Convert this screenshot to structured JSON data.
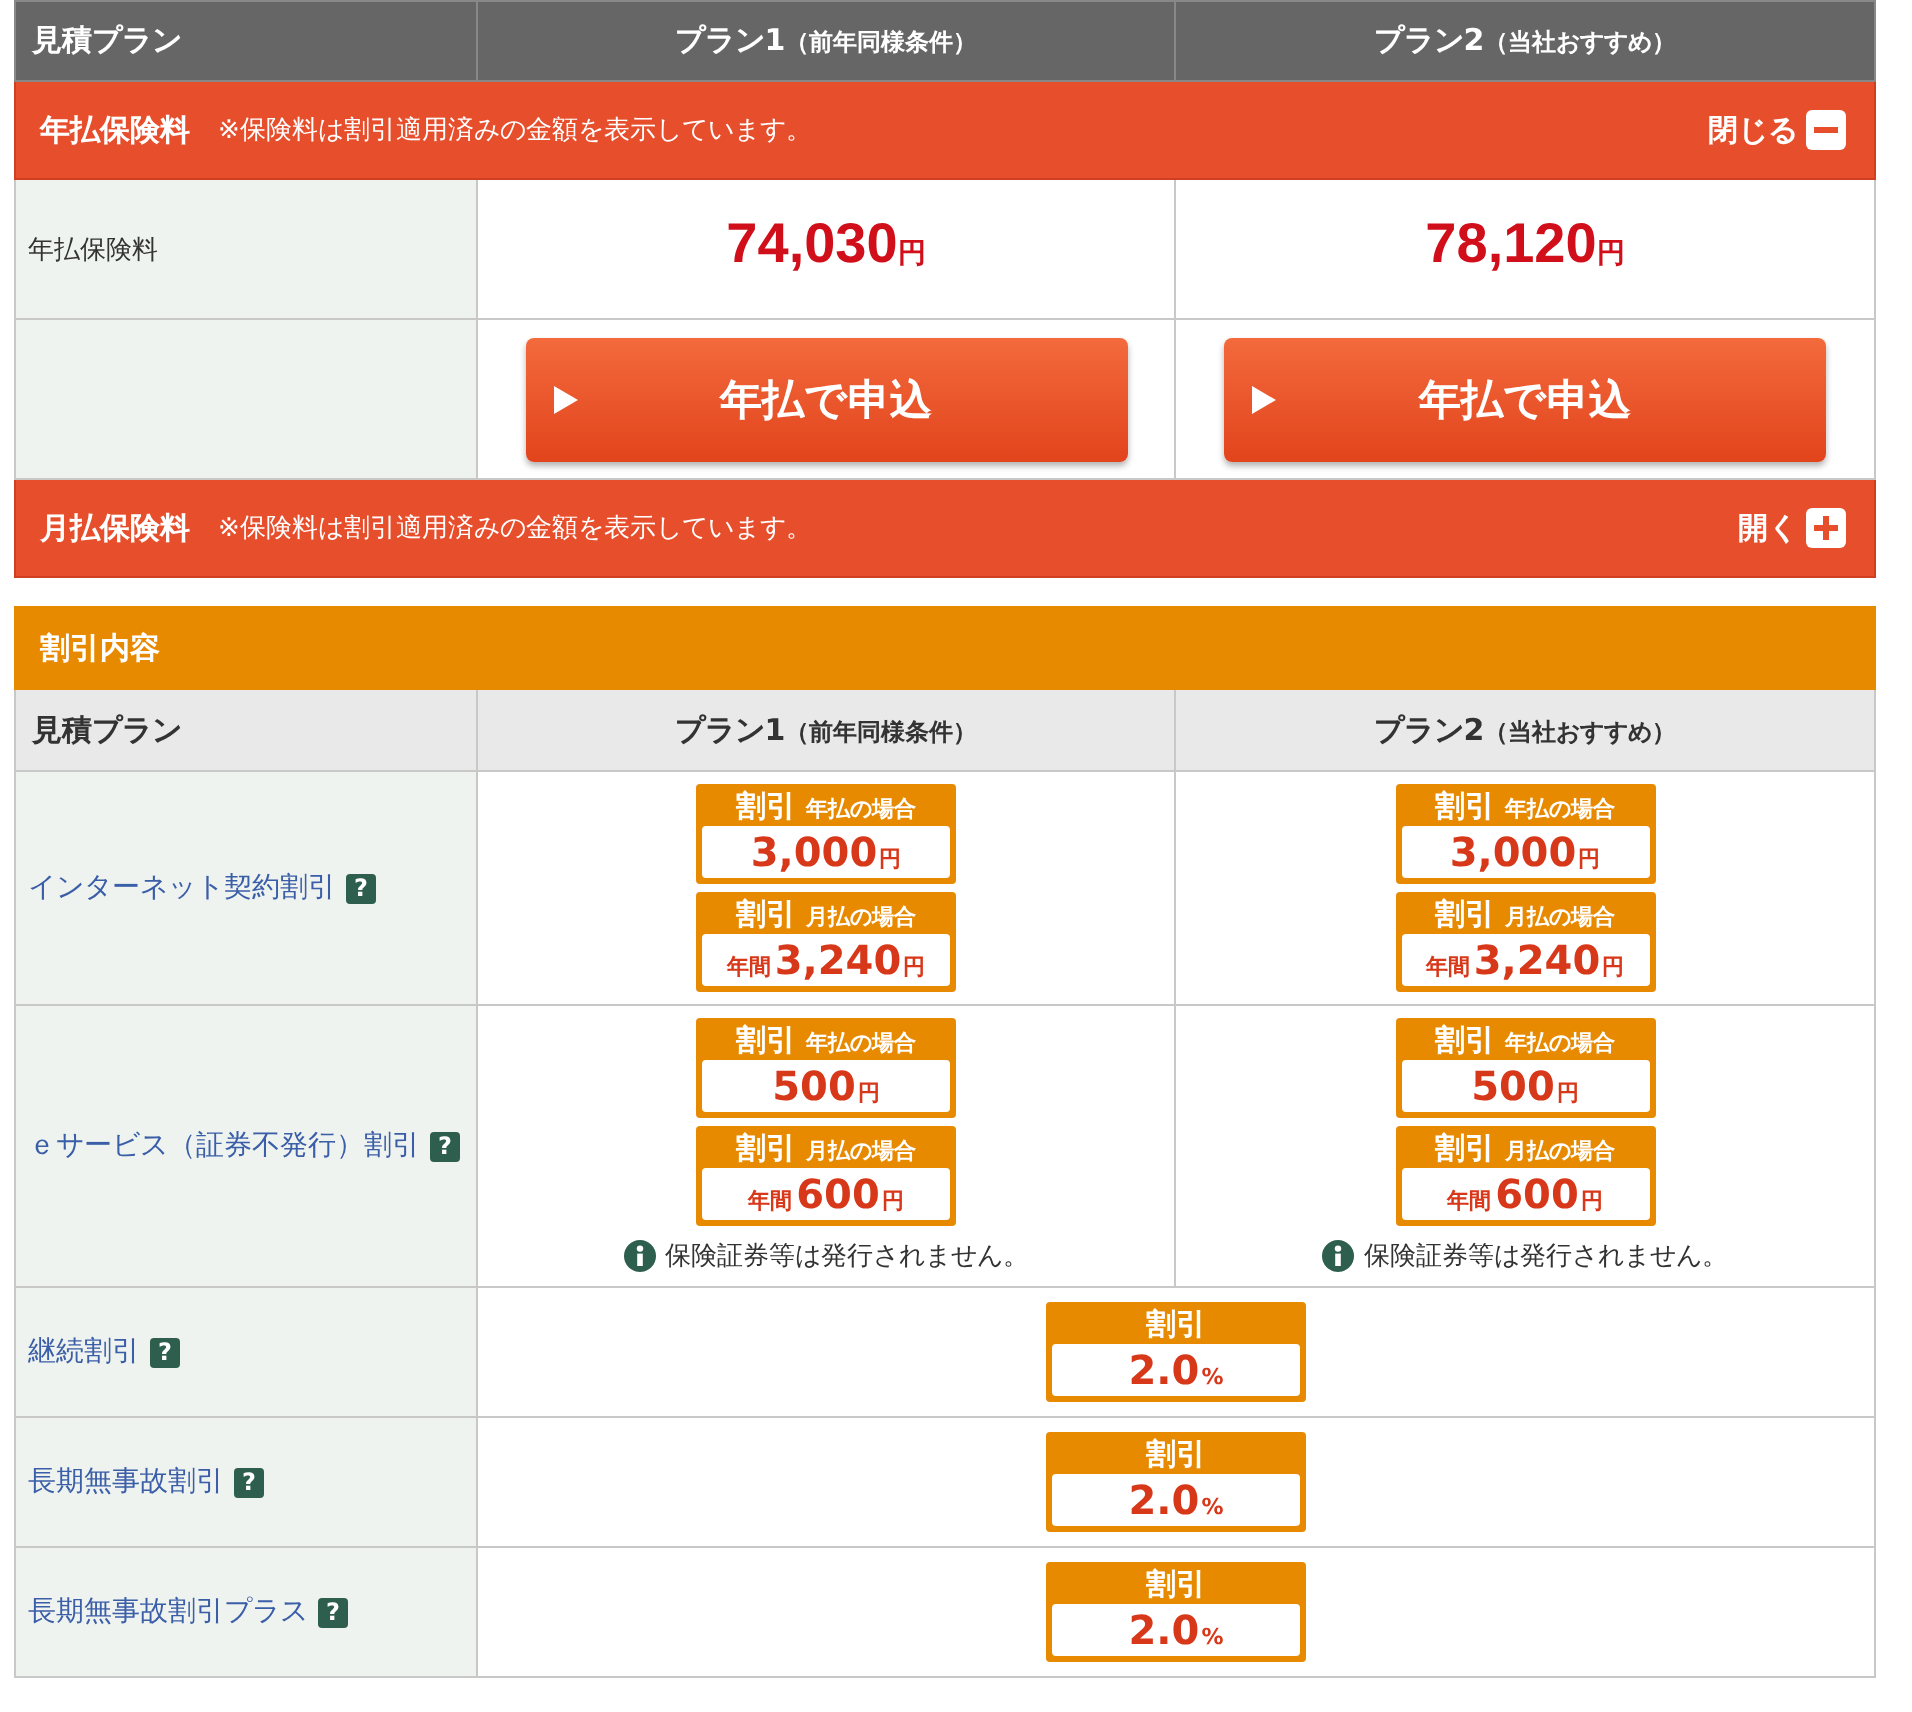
{
  "plans_header": {
    "label": "見積プラン",
    "plans": [
      {
        "name": "プラン1",
        "note": "（前年同様条件）"
      },
      {
        "name": "プラン2",
        "note": "（当社おすすめ）"
      }
    ]
  },
  "annual": {
    "title": "年払保険料",
    "note": "※保険料は割引適用済みの金額を表示しています。",
    "toggle": "閉じる",
    "expanded": true,
    "row_label": "年払保険料",
    "prices": [
      {
        "amount": "74,030",
        "unit": "円"
      },
      {
        "amount": "78,120",
        "unit": "円"
      }
    ],
    "buttons": [
      "年払で申込",
      "年払で申込"
    ]
  },
  "monthly": {
    "title": "月払保険料",
    "note": "※保険料は割引適用済みの金額を表示しています。",
    "toggle": "開く",
    "expanded": false
  },
  "discounts": {
    "title": "割引内容",
    "header": {
      "label": "見積プラン",
      "plans": [
        {
          "name": "プラン1",
          "note": "（前年同様条件）"
        },
        {
          "name": "プラン2",
          "note": "（当社おすすめ）"
        }
      ]
    },
    "rows": [
      {
        "label": "インターネット契約割引",
        "help": "?",
        "kind": "per_plan",
        "plans": [
          {
            "badges": [
              {
                "tag": "割引",
                "condition": "年払の場合",
                "amount": "3,000",
                "unit": "円"
              },
              {
                "tag": "割引",
                "condition": "月払の場合",
                "prefix": "年間",
                "amount": "3,240",
                "unit": "円"
              }
            ]
          },
          {
            "badges": [
              {
                "tag": "割引",
                "condition": "年払の場合",
                "amount": "3,000",
                "unit": "円"
              },
              {
                "tag": "割引",
                "condition": "月払の場合",
                "prefix": "年間",
                "amount": "3,240",
                "unit": "円"
              }
            ]
          }
        ]
      },
      {
        "label": "ｅサービス（証券不発行）割引",
        "help": "?",
        "kind": "per_plan",
        "plans": [
          {
            "badges": [
              {
                "tag": "割引",
                "condition": "年払の場合",
                "amount": "500",
                "unit": "円"
              },
              {
                "tag": "割引",
                "condition": "月払の場合",
                "prefix": "年間",
                "amount": "600",
                "unit": "円"
              }
            ],
            "notice": "保険証券等は発行されません。"
          },
          {
            "badges": [
              {
                "tag": "割引",
                "condition": "年払の場合",
                "amount": "500",
                "unit": "円"
              },
              {
                "tag": "割引",
                "condition": "月払の場合",
                "prefix": "年間",
                "amount": "600",
                "unit": "円"
              }
            ],
            "notice": "保険証券等は発行されません。"
          }
        ]
      },
      {
        "label": "継続割引",
        "help": "?",
        "kind": "shared",
        "badge": {
          "tag": "割引",
          "amount": "2.0",
          "unit": "%"
        }
      },
      {
        "label": "長期無事故割引",
        "help": "?",
        "kind": "shared",
        "badge": {
          "tag": "割引",
          "amount": "2.0",
          "unit": "%"
        }
      },
      {
        "label": "長期無事故割引プラス",
        "help": "?",
        "kind": "shared",
        "badge": {
          "tag": "割引",
          "amount": "2.0",
          "unit": "%"
        }
      }
    ]
  }
}
